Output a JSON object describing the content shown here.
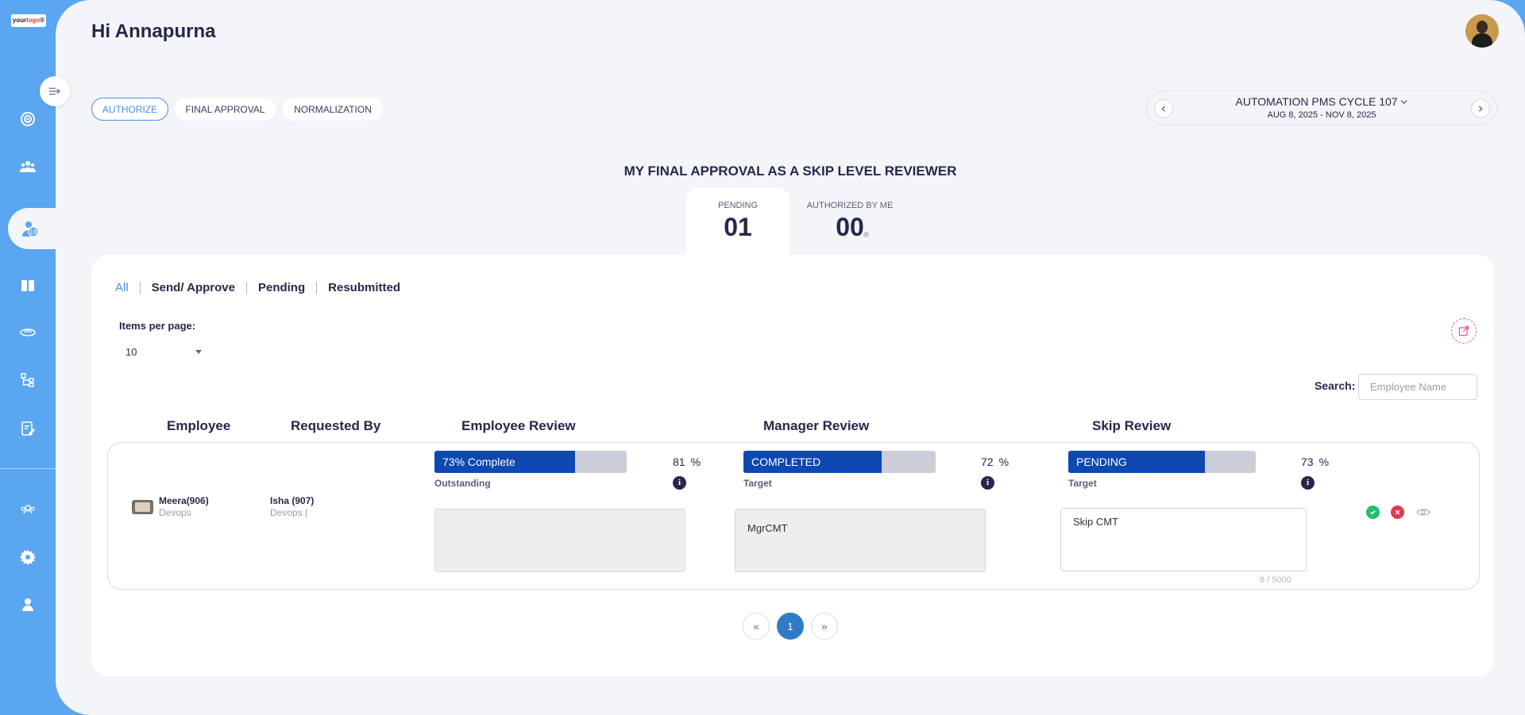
{
  "logo": {
    "text_a": "your",
    "text_b": "logo",
    "mark": "®"
  },
  "sidebar": {
    "items": [
      {
        "icon": "target-icon"
      },
      {
        "icon": "team-icon"
      },
      {
        "icon": "user-badge-icon",
        "badge": "18",
        "active": true
      },
      {
        "icon": "book-icon"
      },
      {
        "icon": "360-icon"
      },
      {
        "icon": "hierarchy-icon"
      },
      {
        "icon": "edit-document-icon"
      },
      {
        "icon": "group-icon"
      },
      {
        "icon": "gear-icon"
      },
      {
        "icon": "person-icon"
      }
    ]
  },
  "header": {
    "greeting": "Hi Annapurna"
  },
  "tabs": [
    "AUTHORIZE",
    "FINAL APPROVAL",
    "NORMALIZATION"
  ],
  "active_tab": "AUTHORIZE",
  "cycle": {
    "title": "AUTOMATION PMS CYCLE 107",
    "dates": "AUG 8, 2025 - NOV 8, 2025"
  },
  "heading": "MY FINAL APPROVAL AS A SKIP LEVEL REVIEWER",
  "status_tabs": {
    "pending": {
      "label": "PENDING",
      "value": "01"
    },
    "authorized": {
      "label": "AUTHORIZED BY ME",
      "value": "00"
    }
  },
  "filters": [
    "All",
    "Send/ Approve",
    "Pending",
    "Resubmitted"
  ],
  "items_per_page": {
    "label": "Items per page:",
    "value": "10"
  },
  "search": {
    "label": "Search:",
    "placeholder": "Employee Name"
  },
  "columns": [
    "Employee",
    "Requested By",
    "Employee Review",
    "Manager Review",
    "Skip Review"
  ],
  "rows": [
    {
      "employee": {
        "name": "Meera(906)",
        "dept": "Devops"
      },
      "requested_by": {
        "name": "Isha (907)",
        "dept": "Devops |"
      },
      "employee_review": {
        "status": "73% Complete",
        "progress": 0.73,
        "score": "81",
        "unit": "%",
        "rating": "Outstanding",
        "comment": ""
      },
      "manager_review": {
        "status": "COMPLETED",
        "progress": 0.72,
        "score": "72",
        "unit": "%",
        "rating": "Target",
        "comment": "MgrCMT"
      },
      "skip_review": {
        "status": "PENDING",
        "progress": 0.73,
        "score": "73",
        "unit": "%",
        "rating": "Target",
        "comment": "Skip CMT",
        "counter": "8 / 5000"
      }
    }
  ],
  "pagination": {
    "prev": "«",
    "current": "1",
    "next": "»"
  },
  "colors": {
    "accent": "#5aa6f0",
    "progress": "#0e48b0",
    "approve": "#22c16b",
    "reject": "#e53950"
  }
}
